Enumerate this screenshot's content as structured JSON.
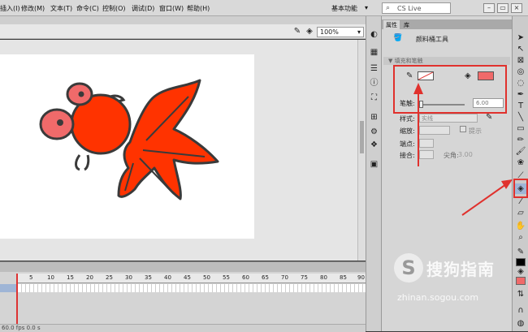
{
  "menu": [
    "插入(I)",
    "修改(M)",
    "文本(T)",
    "命令(C)",
    "控制(O)",
    "调试(D)",
    "窗口(W)",
    "帮助(H)"
  ],
  "workspace": {
    "label": "基本功能",
    "caret": "▾"
  },
  "search": {
    "placeholder": "CS Live",
    "icon": "search-icon"
  },
  "window_buttons": [
    "minimize-icon",
    "restore-icon",
    "close-icon"
  ],
  "stage": {
    "zoom": "100%",
    "zoom_caret": "▾"
  },
  "timeline": {
    "frame_numbers": [
      "5",
      "10",
      "15",
      "20",
      "25",
      "30",
      "35",
      "40",
      "45",
      "50",
      "55",
      "60",
      "65",
      "70",
      "75",
      "80",
      "85",
      "90"
    ],
    "footer": "60.0 fps  0.0 s"
  },
  "properties": {
    "tabs": [
      "属性",
      "库"
    ],
    "tool_name": "颜料桶工具",
    "section": "▼ 填充和笔触",
    "stroke_width_label": "笔触:",
    "stroke_width_value": "6.00",
    "style_label": "样式:",
    "style_value": "实线",
    "scale_label": "缩放:",
    "hint_label": "提示",
    "cap_label": "端点:",
    "join_label": "接合:",
    "miter_label": "尖角:",
    "miter_value": "3.00",
    "stroke_color": "#ffffff",
    "fill_color": "#f06a6a"
  },
  "colors": {
    "goldfish_body": "#ff3300",
    "goldfish_eye": "#f06a6a",
    "outline": "#3a3a3a",
    "highlight": "#e0312d"
  },
  "watermark": {
    "brand": "搜狗指南",
    "url": "zhinan.sogou.com"
  }
}
